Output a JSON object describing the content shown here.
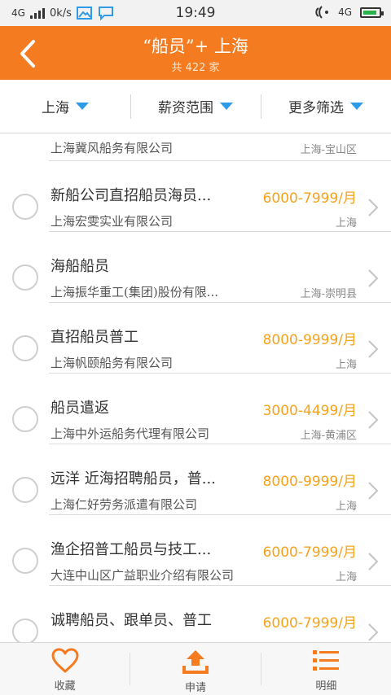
{
  "status_bar": {
    "network": "4G",
    "speed": "0k/s",
    "time": "19:49",
    "network_right": "4G"
  },
  "header": {
    "title": "“船员”+ 上海",
    "subtitle": "共 422 家"
  },
  "filters": [
    {
      "label": "上海"
    },
    {
      "label": "薪资范围"
    },
    {
      "label": "更多筛选"
    }
  ],
  "jobs": [
    {
      "title": "",
      "salary": "",
      "company": "上海冀风船务有限公司",
      "location": "上海-宝山区"
    },
    {
      "title": "新船公司直招船员海员...",
      "salary": "6000-7999/月",
      "company": "上海宏雯实业有限公司",
      "location": "上海"
    },
    {
      "title": "海船船员",
      "salary": "",
      "company": "上海振华重工(集团)股份有限...",
      "location": "上海-崇明县"
    },
    {
      "title": "直招船员普工",
      "salary": "8000-9999/月",
      "company": "上海帆颐船务有限公司",
      "location": "上海"
    },
    {
      "title": "船员遣返",
      "salary": "3000-4499/月",
      "company": "上海中外运船务代理有限公司",
      "location": "上海-黄浦区"
    },
    {
      "title": "远洋 近海招聘船员，普...",
      "salary": "8000-9999/月",
      "company": "上海仁好劳务派遣有限公司",
      "location": "上海"
    },
    {
      "title": "渔企招普工船员与技工...",
      "salary": "6000-7999/月",
      "company": "大连中山区广益职业介绍有限公司",
      "location": "上海"
    },
    {
      "title": "诚聘船员、跟单员、普工",
      "salary": "6000-7999/月",
      "company": "",
      "location": ""
    }
  ],
  "bottom_tabs": [
    {
      "label": "收藏",
      "icon": "heart-icon"
    },
    {
      "label": "申请",
      "icon": "upload-icon"
    },
    {
      "label": "明细",
      "icon": "list-icon"
    }
  ],
  "colors": {
    "accent": "#f57b20",
    "salary": "#f6a21c",
    "filter_arrow": "#2f9be6"
  }
}
